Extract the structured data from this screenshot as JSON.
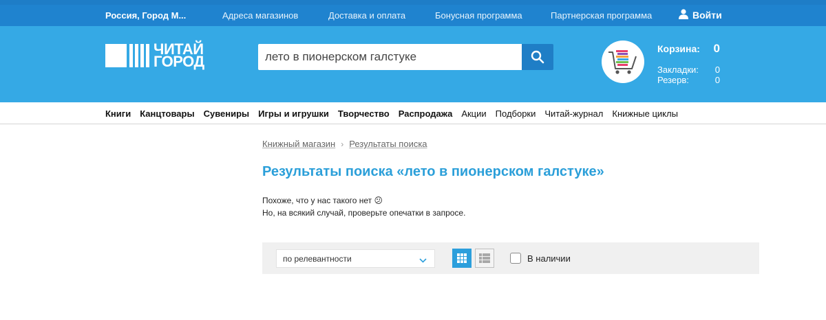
{
  "topbar": {
    "region": "Россия, Город М...",
    "links": [
      "Адреса магазинов",
      "Доставка и оплата",
      "Бонусная программа",
      "Партнерская программа"
    ],
    "login": "Войти"
  },
  "logo": {
    "line1": "ЧИТАЙ",
    "line2": "ГОРОД"
  },
  "search": {
    "value": "лето в пионерском галстуке"
  },
  "cart": {
    "label": "Корзина:",
    "count": "0",
    "bookmarks_label": "Закладки:",
    "bookmarks": "0",
    "reserve_label": "Резерв:",
    "reserve": "0"
  },
  "nav": {
    "bold": [
      "Книги",
      "Канцтовары",
      "Сувениры",
      "Игры и игрушки",
      "Творчество",
      "Распродажа"
    ],
    "regular": [
      "Акции",
      "Подборки",
      "Читай-журнал",
      "Книжные циклы"
    ]
  },
  "breadcrumb": {
    "home": "Книжный магазин",
    "sep": "›",
    "current": "Результаты поиска"
  },
  "results": {
    "title": "Результаты поиска «лето в пионерском галстуке»",
    "line1": "Похоже, что у нас такого нет 😕",
    "line2": "Но, на всякий случай, проверьте опечатки в запросе."
  },
  "filters": {
    "sort_value": "по релевантности",
    "in_stock_label": "В наличии"
  },
  "colors": {
    "header_bg": "#35a9e5",
    "topbar_bg": "#1f83cf",
    "search_button": "#1f7ec6",
    "title": "#2b9fd9"
  }
}
